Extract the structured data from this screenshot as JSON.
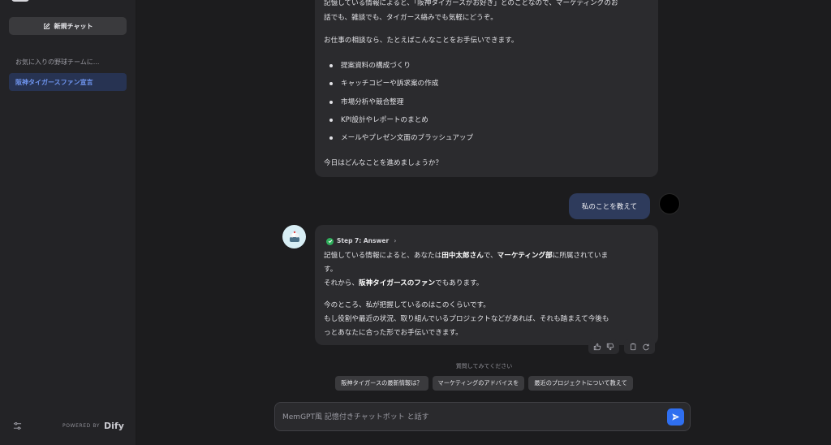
{
  "sidebar": {
    "new_chat_label": "新規チャット",
    "conversations": [
      {
        "label": "お気に入りの野球チームに..."
      },
      {
        "label": "阪神タイガースファン宣言"
      }
    ],
    "powered_by": "POWERED BY",
    "brand": "Dify"
  },
  "chat": {
    "bot_message_1": {
      "intro": "記憶している情報によると、「阪神タイガースがお好き」とのことなので、マーケティングのお",
      "intro_line2": "話でも、雑談でも、タイガース絡みでも気軽にどうぞ。",
      "lead": "お仕事の相談なら、たとえばこんなことをお手伝いできます。",
      "items": [
        {
          "text": "提案資料の構成づくり"
        },
        {
          "text": "キャッチコピーや訴求案の作成"
        },
        {
          "text": "市場分析や競合整理"
        },
        {
          "text": "KPI設計やレポートのまとめ"
        },
        {
          "text": "メールやプレゼン文面のブラッシュアップ"
        }
      ],
      "closing": "今日はどんなことを進めましょうか？"
    },
    "user_message": "私のことを教えて",
    "bot_message_2": {
      "step_label": "Step 7: Answer",
      "line1_a": "記憶している情報によると、あなたは",
      "line1_b": "田中太郎さん",
      "line1_c": "で、",
      "line1_d": "マーケティング部",
      "line1_e": "に所属されていま",
      "line2": "す。",
      "line3_a": "それから、",
      "line3_b": "阪神タイガースのファン",
      "line3_c": "でもあります。",
      "line4": "今のところ、私が把握しているのはこのくらいです。",
      "line5": "もし役割や最近の状況、取り組んでいるプロジェクトなどがあれば、それも踏まえて今後も",
      "line6": "っとあなたに合った形でお手伝いできます。"
    }
  },
  "suggestions": {
    "title": "質問してみてください",
    "chips": [
      {
        "label": "阪神タイガースの最新情報は？"
      },
      {
        "label": "マーケティングのアドバイスを"
      },
      {
        "label": "最近のプロジェクトについて教えて"
      }
    ]
  },
  "input": {
    "placeholder": "MemGPT風 記憶付きチャットボット と話す"
  },
  "colors": {
    "accent": "#2f6ff0",
    "active_conv_bg": "#273352",
    "user_bubble": "#2e3b5c",
    "success": "#2fae5b"
  }
}
